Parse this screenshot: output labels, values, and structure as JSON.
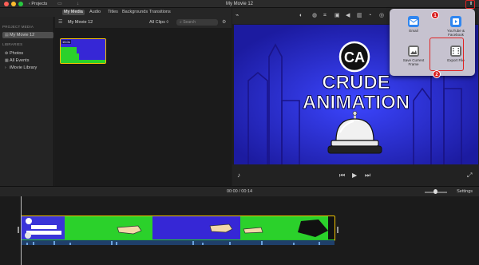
{
  "titlebar": {
    "back_label": "‹ Projects",
    "window_title": "My Movie 12",
    "settings_icon": "gear-icon"
  },
  "media_tabs": [
    "My Media",
    "Audio",
    "Titles",
    "Backgrounds",
    "Transitions"
  ],
  "sidebar": {
    "project_heading": "PROJECT MEDIA",
    "project_item": "My Movie 12",
    "libraries_heading": "LIBRARIES",
    "library_items": [
      "Photos",
      "All Events",
      "iMovie Library"
    ]
  },
  "browser": {
    "title": "My Movie 12",
    "filter": "All Clips ◊",
    "search_placeholder": "Search",
    "clip_duration": "15.0s"
  },
  "viewer": {
    "logo_text": "CA",
    "headline_line1": "CRUDE",
    "headline_line2": "ANIMATION"
  },
  "share_popover": {
    "items": [
      {
        "label": "Email",
        "icon": "mail-icon",
        "color": "#2f86f0"
      },
      {
        "label": "YouTube & Facebook",
        "icon": "youtube-icon",
        "color": "#2f86f0"
      },
      {
        "label": "Save Current Frame",
        "icon": "image-icon",
        "color": "#6c6c6c"
      },
      {
        "label": "Export File",
        "icon": "film-icon",
        "color": "#6c6c6c"
      }
    ],
    "steps": [
      "1",
      "2"
    ]
  },
  "timeline": {
    "timecode_current": "00:00",
    "timecode_total": "00:14",
    "separator": "/",
    "settings_label": "Settings"
  }
}
